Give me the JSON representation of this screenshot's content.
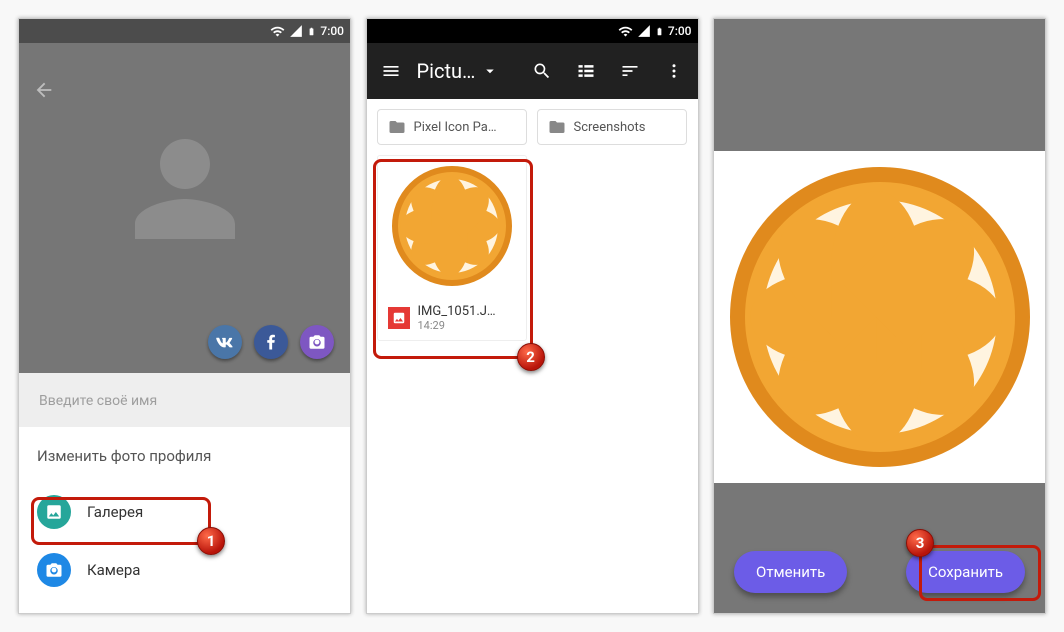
{
  "status": {
    "time": "7:00"
  },
  "p1": {
    "name_placeholder": "Введите своё имя",
    "sheet_title": "Изменить фото профиля",
    "gallery": "Галерея",
    "camera": "Камера",
    "badge1": "1"
  },
  "p2": {
    "title": "Pictu…",
    "folder1": "Pixel Icon Pa…",
    "folder2": "Screenshots",
    "file_name": "IMG_1051.J…",
    "file_time": "14:29",
    "badge2": "2"
  },
  "p3": {
    "cancel": "Отменить",
    "save": "Сохранить",
    "badge3": "3"
  }
}
